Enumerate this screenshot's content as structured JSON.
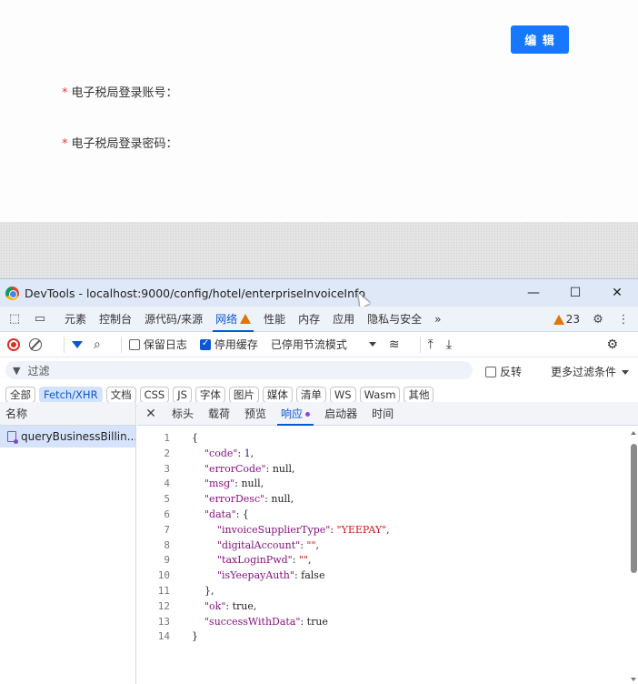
{
  "page": {
    "edit_button": "编 辑",
    "fields": [
      {
        "required": "*",
        "label": "电子税局登录账号："
      },
      {
        "required": "*",
        "label": "电子税局登录密码："
      }
    ]
  },
  "devtools": {
    "window_title": "DevTools - localhost:9000/config/hotel/enterpriseInvoiceInfo",
    "window_controls": [
      "—",
      "☐",
      "✕"
    ],
    "main_tabs": [
      "元素",
      "控制台",
      "源代码/来源",
      "网络",
      "性能",
      "内存",
      "应用",
      "隐私与安全"
    ],
    "active_main_tab": "网络",
    "more_tabs": "»",
    "warning_count": "23",
    "toolbar": {
      "preserve_log": "保留日志",
      "disable_cache": "停用缓存",
      "throttle": "已停用节流模式"
    },
    "filter": {
      "placeholder": "过滤",
      "invert": "反转",
      "more_filters": "更多过滤条件"
    },
    "type_chips": [
      "全部",
      "Fetch/XHR",
      "文档",
      "CSS",
      "JS",
      "字体",
      "图片",
      "媒体",
      "清单",
      "WS",
      "Wasm",
      "其他"
    ],
    "active_chip": "Fetch/XHR",
    "request_list": {
      "header": "名称",
      "requests": [
        "queryBusinessBillin..."
      ]
    },
    "detail_tabs": [
      "标头",
      "载荷",
      "预览",
      "响应",
      "启动器",
      "时间"
    ],
    "active_detail_tab": "响应",
    "response_lines": [
      {
        "num": "1",
        "text": "{"
      },
      {
        "num": "2",
        "text": "    \"code\": 1,"
      },
      {
        "num": "3",
        "text": "    \"errorCode\": null,"
      },
      {
        "num": "4",
        "text": "    \"msg\": null,"
      },
      {
        "num": "5",
        "text": "    \"errorDesc\": null,"
      },
      {
        "num": "6",
        "text": "    \"data\": {"
      },
      {
        "num": "7",
        "text": "        \"invoiceSupplierType\": \"YEEPAY\","
      },
      {
        "num": "8",
        "text": "        \"digitalAccount\": \"\","
      },
      {
        "num": "9",
        "text": "        \"taxLoginPwd\": \"\","
      },
      {
        "num": "10",
        "text": "        \"isYeepayAuth\": false"
      },
      {
        "num": "11",
        "text": "    },"
      },
      {
        "num": "12",
        "text": "    \"ok\": true,"
      },
      {
        "num": "13",
        "text": "    \"successWithData\": true"
      },
      {
        "num": "14",
        "text": "}"
      }
    ]
  },
  "colors": {
    "primary_button": "#1677ff",
    "accent": "#0b57d0",
    "required": "#e5413b",
    "warning": "#e37400"
  }
}
